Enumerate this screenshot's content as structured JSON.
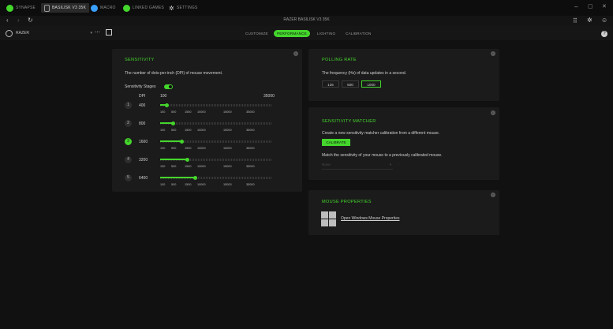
{
  "titlebar": {
    "tabs": [
      {
        "label": "SYNAPSE",
        "active": false
      },
      {
        "label": "BASILISK V3 35K",
        "active": true
      },
      {
        "label": "MACRO",
        "active": false
      },
      {
        "label": "LINKED GAMES",
        "active": false
      },
      {
        "label": "SETTINGS",
        "active": false
      }
    ],
    "window_controls": [
      "–",
      "▢",
      "✕"
    ]
  },
  "header": {
    "device_title": "RAZER BASILISK V3 35K"
  },
  "profile": {
    "selected": "RAZER"
  },
  "subtabs": [
    {
      "label": "CUSTOMIZE",
      "active": false
    },
    {
      "label": "PERFORMANCE",
      "active": true
    },
    {
      "label": "LIGHTING",
      "active": false
    },
    {
      "label": "CALIBRATION",
      "active": false
    }
  ],
  "sensitivity": {
    "title": "SENSITIVITY",
    "description": "The number of dots-per-inch (DPI) of mouse movement.",
    "stages_label": "Sensitivity Stages",
    "stages_enabled": true,
    "dpi_header": "DPI",
    "range_min": "100",
    "range_max": "35000",
    "tick_labels": [
      "100",
      "500",
      "1500",
      "10000",
      "15000",
      "35000"
    ],
    "stages": [
      {
        "number": "1",
        "dpi": "400",
        "active": false,
        "fraction": 0.06
      },
      {
        "number": "2",
        "dpi": "800",
        "active": false,
        "fraction": 0.11
      },
      {
        "number": "3",
        "dpi": "1600",
        "active": true,
        "fraction": 0.19
      },
      {
        "number": "4",
        "dpi": "3200",
        "active": false,
        "fraction": 0.24
      },
      {
        "number": "5",
        "dpi": "6400",
        "active": false,
        "fraction": 0.31
      }
    ]
  },
  "polling": {
    "title": "POLLING RATE",
    "description": "The frequency (Hz) of data updates in a second.",
    "options": [
      {
        "label": "125",
        "active": false
      },
      {
        "label": "500",
        "active": false
      },
      {
        "label": "1000",
        "active": true
      }
    ]
  },
  "matcher": {
    "title": "SENSITIVITY MATCHER",
    "description": "Create a new sensitivity matcher calibration from a different mouse.",
    "button": "CALIBRATE",
    "match_text": "Match the sensitivity of your mouse to a previously calibrated mouse.",
    "select_value": "None"
  },
  "mouse_properties": {
    "title": "MOUSE PROPERTIES",
    "link": "Open Windows Mouse Properties"
  },
  "colors": {
    "accent": "#44d62c",
    "panel": "#1b1b1b",
    "background": "#111111"
  }
}
